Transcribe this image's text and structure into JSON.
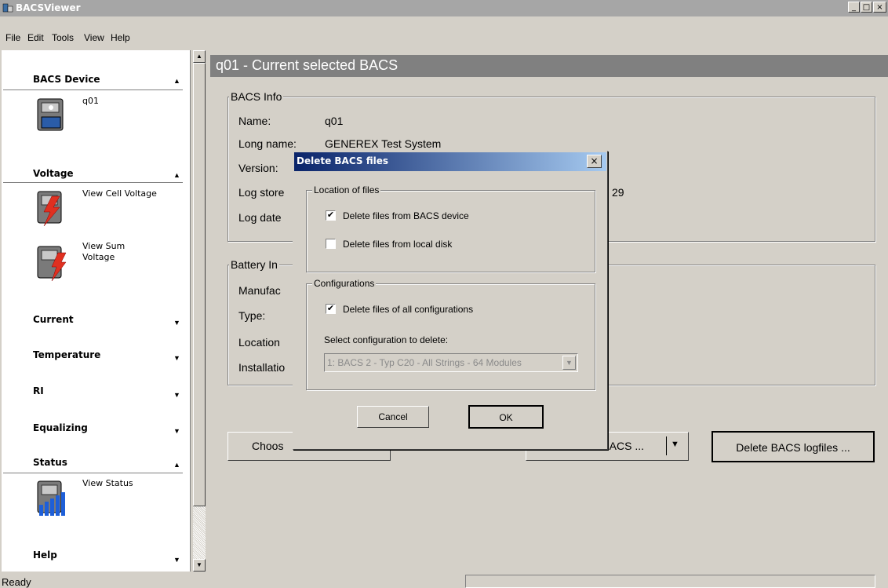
{
  "window": {
    "title": "BACSViewer",
    "min": "_",
    "max": "□",
    "close": "×"
  },
  "menu": [
    "File",
    "Edit",
    "Tools",
    "View",
    "Help"
  ],
  "sidebar": {
    "sections": [
      {
        "title": "BACS Device",
        "arrow": "▲",
        "items": [
          {
            "label": "q01"
          }
        ]
      },
      {
        "title": "Voltage",
        "arrow": "▲",
        "items": [
          {
            "label": "View Cell Voltage"
          },
          {
            "label": "View Sum Voltage"
          }
        ]
      },
      {
        "title": "Current",
        "arrow": "▼"
      },
      {
        "title": "Temperature",
        "arrow": "▼"
      },
      {
        "title": "RI",
        "arrow": "▼"
      },
      {
        "title": "Equalizing",
        "arrow": "▼"
      },
      {
        "title": "Status",
        "arrow": "▲",
        "items": [
          {
            "label": "View Status"
          }
        ]
      },
      {
        "title": "Help",
        "arrow": "▼"
      }
    ]
  },
  "main": {
    "title": "q01 - Current selected BACS",
    "bacs_info": {
      "group_label": "BACS Info",
      "rows": [
        {
          "label": "Name:",
          "value": "q01"
        },
        {
          "label": "Long name:",
          "value": "GENEREX Test System"
        },
        {
          "label": "Version:",
          "value": ""
        },
        {
          "label": "Log store",
          "value": "29"
        },
        {
          "label": "Log date",
          "value": ""
        }
      ]
    },
    "battery_info": {
      "group_label": "Battery In",
      "rows": [
        "Manufac",
        "Type:",
        "Location",
        "Installatio"
      ]
    },
    "buttons": {
      "choose": "Choos",
      "bacs_dropdown": "BACS ...",
      "delete_logfiles": "Delete BACS logfiles ..."
    }
  },
  "dialog": {
    "title": "Delete BACS files",
    "close": "×",
    "location_group": "Location of files",
    "cb_device": {
      "label": "Delete files from BACS device",
      "checked": true
    },
    "cb_local": {
      "label": "Delete files from local disk",
      "checked": false
    },
    "config_group": "Configurations",
    "cb_all_configs": {
      "label": "Delete files of all configurations",
      "checked": true
    },
    "select_label": "Select configuration to delete:",
    "select_value": "1: BACS 2 - Typ C20 - All Strings - 64 Modules",
    "cancel": "Cancel",
    "ok": "OK"
  },
  "status": {
    "text": "Ready"
  }
}
